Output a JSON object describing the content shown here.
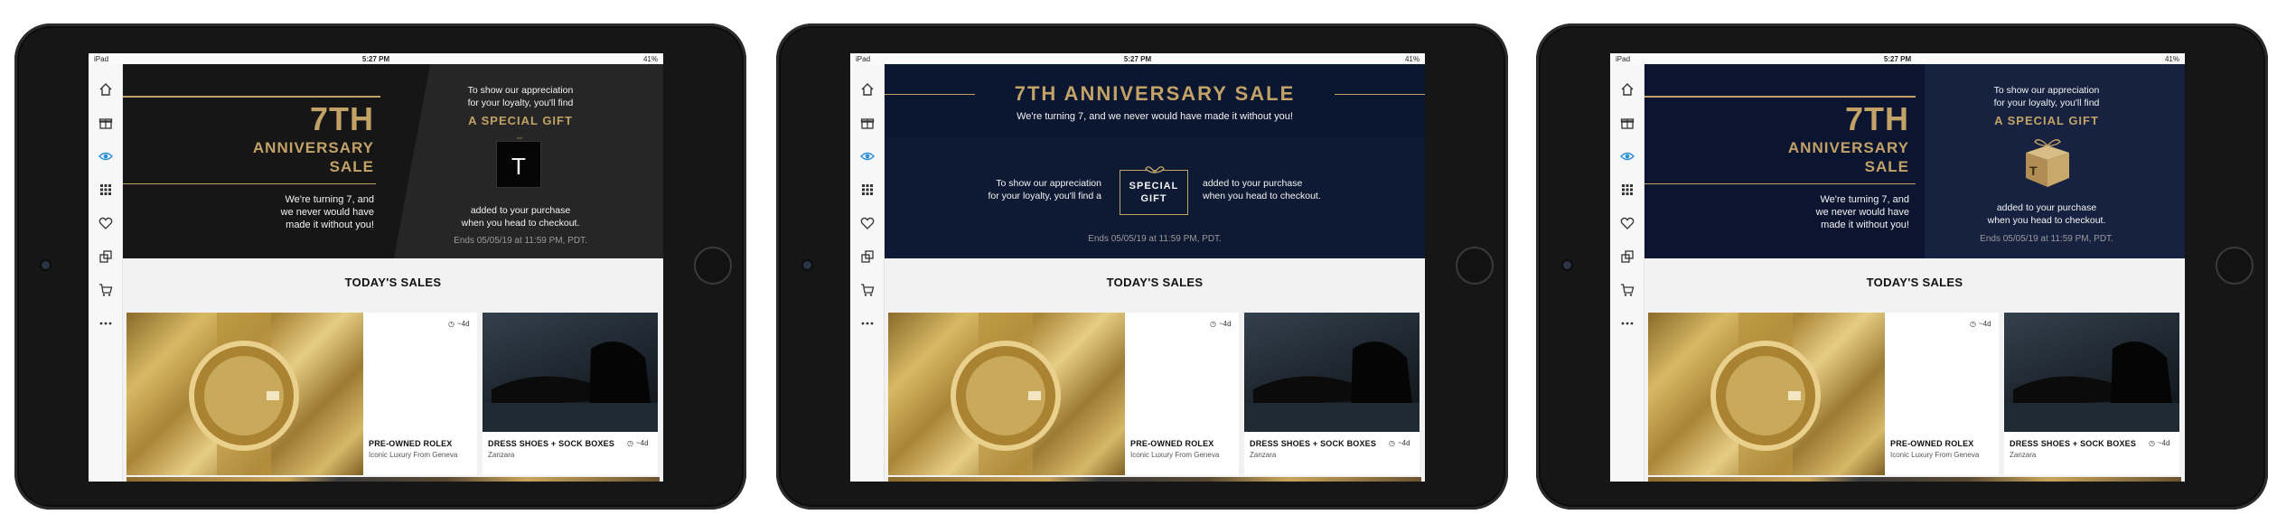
{
  "status": {
    "carrier": "iPad",
    "time": "5:27 PM",
    "battery": "41%"
  },
  "sidebar": [
    "home-icon",
    "gift-icon",
    "eye-icon",
    "grid-icon",
    "heart-icon",
    "copy-icon",
    "cart-icon",
    "more-icon"
  ],
  "banner_a": {
    "big": "7TH",
    "title1": "ANNIVERSARY",
    "title2": "SALE",
    "tagline1": "We're turning 7, and",
    "tagline2": "we never would have",
    "tagline3": "made it without you!",
    "appr1": "To show our appreciation",
    "appr2": "for your loyalty, you'll find",
    "gift": "A SPECIAL GIFT",
    "gift_letter": "T",
    "added1": "added to your purchase",
    "added2": "when you head to checkout.",
    "ends": "Ends 05/05/19 at 11:59 PM, PDT."
  },
  "banner_b": {
    "title": "7TH ANNIVERSARY SALE",
    "tagline": "We're turning 7, and we never would have made it without you!",
    "appr1": "To show our appreciation",
    "appr2": "for your loyalty, you'll find a",
    "gift1": "SPECIAL",
    "gift2": "GIFT",
    "added1": "added to your purchase",
    "added2": "when you head to checkout.",
    "ends": "Ends 05/05/19 at 11:59 PM, PDT."
  },
  "banner_c": {
    "big": "7TH",
    "title1": "ANNIVERSARY",
    "title2": "SALE",
    "tagline1": "We're turning 7, and",
    "tagline2": "we never would have",
    "tagline3": "made it without you!",
    "appr1": "To show our appreciation",
    "appr2": "for your loyalty, you'll find",
    "gift": "A SPECIAL GIFT",
    "gift_letter": "T",
    "added1": "added to your purchase",
    "added2": "when you head to checkout.",
    "ends": "Ends 05/05/19 at 11:59 PM, PDT."
  },
  "todays_sales": "TODAY'S SALES",
  "card1": {
    "title": "PRE-OWNED ROLEX",
    "subtitle": "Iconic Luxury From Geneva",
    "time": "~4d"
  },
  "card2": {
    "title": "DRESS SHOES + SOCK BOXES",
    "subtitle": "Zanzara",
    "time": "~4d"
  },
  "colors": {
    "gold": "#c3a268",
    "dark_a": "#1b1b1b",
    "navy": "#0e1a33",
    "accent_blue": "#2a8fd6"
  }
}
